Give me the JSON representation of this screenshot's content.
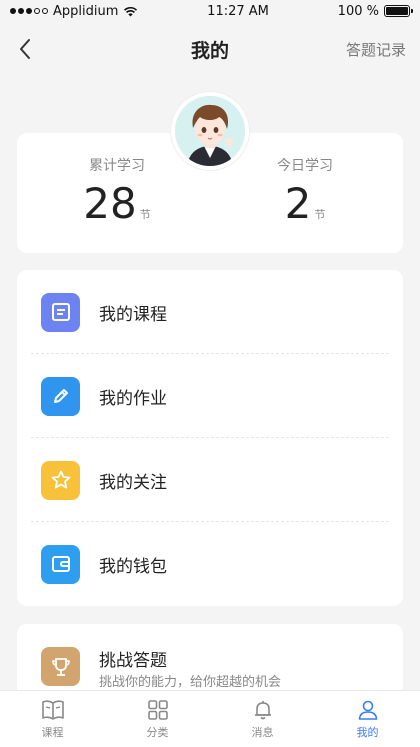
{
  "status_bar": {
    "carrier": "Applidium",
    "time": "11:27 AM",
    "battery": "100 %"
  },
  "nav": {
    "title": "我的",
    "right_action": "答题记录"
  },
  "stats": {
    "total": {
      "label": "累计学习",
      "value": "28",
      "unit": "节"
    },
    "today": {
      "label": "今日学习",
      "value": "2",
      "unit": "节"
    }
  },
  "menu": {
    "items": [
      {
        "label": "我的课程",
        "icon": "list-icon",
        "color": "#6c83f1"
      },
      {
        "label": "我的作业",
        "icon": "pencil-icon",
        "color": "#2f95ee"
      },
      {
        "label": "我的关注",
        "icon": "star-icon",
        "color": "#f7c23a"
      },
      {
        "label": "我的钱包",
        "icon": "wallet-icon",
        "color": "#2e9ef0"
      }
    ]
  },
  "challenge": {
    "title": "挑战答题",
    "subtitle": "挑战你的能力，给你超越的机会",
    "icon": "trophy-icon",
    "color": "#d2a46e"
  },
  "tabs": [
    {
      "label": "课程",
      "icon": "book-icon",
      "active": false
    },
    {
      "label": "分类",
      "icon": "grid-icon",
      "active": false
    },
    {
      "label": "消息",
      "icon": "bell-icon",
      "active": false
    },
    {
      "label": "我的",
      "icon": "user-icon",
      "active": true
    }
  ],
  "colors": {
    "accent": "#3a7cf3",
    "background": "#f4f4f5"
  }
}
